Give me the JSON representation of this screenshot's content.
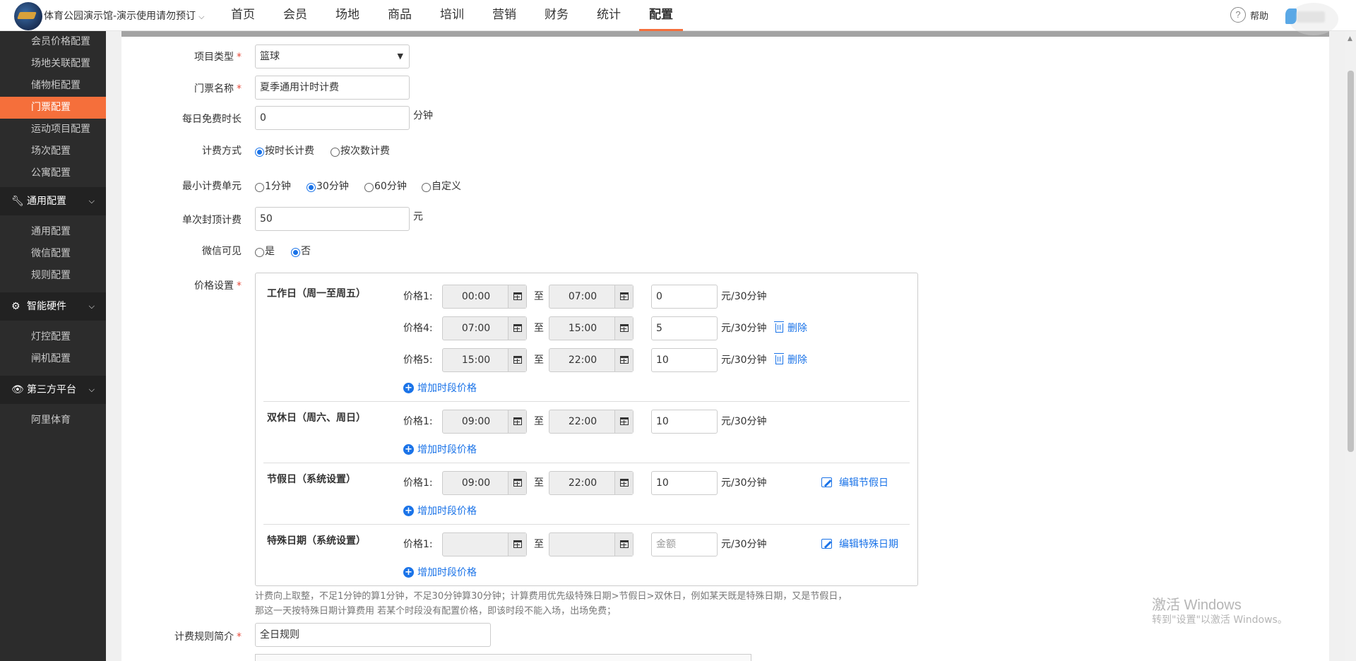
{
  "header": {
    "venue_name": "体育公园演示馆-演示使用请勿预订",
    "nav": [
      "首页",
      "会员",
      "场地",
      "商品",
      "培训",
      "营销",
      "财务",
      "统计",
      "配置"
    ],
    "active_nav": "配置",
    "help_label": "帮助"
  },
  "sidebar": {
    "items_top": [
      "会员价格配置",
      "场地关联配置",
      "储物柜配置",
      "门票配置",
      "运动项目配置",
      "场次配置",
      "公寓配置"
    ],
    "active_item": "门票配置",
    "groups": [
      {
        "title": "通用配置",
        "icon": "wrench-icon",
        "items": [
          "通用配置",
          "微信配置",
          "规则配置"
        ]
      },
      {
        "title": "智能硬件",
        "icon": "gear-icon",
        "items": [
          "灯控配置",
          "闸机配置"
        ]
      },
      {
        "title": "第三方平台",
        "icon": "eye-icon",
        "items": [
          "阿里体育"
        ]
      }
    ]
  },
  "form": {
    "project_type": {
      "label": "项目类型",
      "value": "篮球"
    },
    "ticket_name": {
      "label": "门票名称",
      "value": "夏季通用计时计费"
    },
    "free_duration": {
      "label": "每日免费时长",
      "value": "0",
      "unit": "分钟"
    },
    "billing_method": {
      "label": "计费方式",
      "options": [
        "按时长计费",
        "按次数计费"
      ],
      "selected": "按时长计费"
    },
    "min_unit": {
      "label": "最小计费单元",
      "options": [
        "1分钟",
        "30分钟",
        "60分钟",
        "自定义"
      ],
      "selected": "30分钟"
    },
    "cap": {
      "label": "单次封顶计费",
      "value": "50",
      "unit": "元"
    },
    "wechat_visible": {
      "label": "微信可见",
      "options": [
        "是",
        "否"
      ],
      "selected": "否"
    },
    "price_settings_label": "价格设置",
    "rule_intro": {
      "label": "计费规则简介",
      "value": "全日规则"
    }
  },
  "price": {
    "sep": "至",
    "unit": "元/30分钟",
    "add_label": "增加时段价格",
    "delete_label": "删除",
    "sections": {
      "weekday": {
        "title": "工作日（周一至周五）",
        "rows": [
          {
            "label": "价格1:",
            "start": "00:00",
            "end": "07:00",
            "amount": "0"
          },
          {
            "label": "价格4:",
            "start": "07:00",
            "end": "15:00",
            "amount": "5"
          },
          {
            "label": "价格5:",
            "start": "15:00",
            "end": "22:00",
            "amount": "10"
          }
        ]
      },
      "weekend": {
        "title": "双休日（周六、周日）",
        "rows": [
          {
            "label": "价格1:",
            "start": "09:00",
            "end": "22:00",
            "amount": "10"
          }
        ]
      },
      "holiday": {
        "title": "节假日（系统设置）",
        "edit_label": "编辑节假日",
        "rows": [
          {
            "label": "价格1:",
            "start": "09:00",
            "end": "22:00",
            "amount": "10"
          }
        ]
      },
      "special": {
        "title": "特殊日期（系统设置）",
        "edit_label": "编辑特殊日期",
        "rows": [
          {
            "label": "价格1:",
            "start": "",
            "end": "",
            "amount_placeholder": "金额"
          }
        ]
      }
    },
    "hint_line1": "计费向上取整，不足1分钟的算1分钟，不足30分钟算30分钟；计算费用优先级特殊日期>节假日>双休日，例如某天既是特殊日期，又是节假日，",
    "hint_line2": "那这一天按特殊日期计算费用 若某个时段没有配置价格，即该时段不能入场，出场免费；"
  },
  "watermark": {
    "line1": "激活 Windows",
    "line2": "转到\"设置\"以激活 Windows。"
  },
  "colors": {
    "accent": "#f56f3b",
    "link": "#1a73e8",
    "sidebar_bg": "#2c2c2c"
  }
}
